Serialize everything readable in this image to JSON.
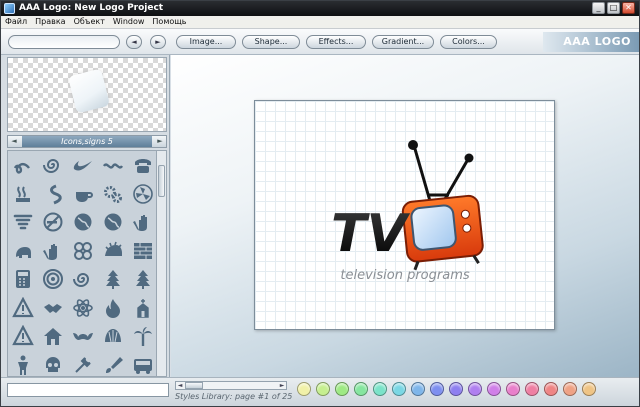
{
  "window": {
    "title": "AAA Logo: New Logo Project",
    "controls": {
      "minimize": "_",
      "maximize": "□",
      "close": "✕"
    }
  },
  "menu": {
    "items": [
      "Файл",
      "Правка",
      "Объект",
      "Window",
      "Помощь"
    ]
  },
  "toolbar": {
    "nav_back": "◄",
    "nav_forward": "►",
    "buttons": [
      "Image...",
      "Shape...",
      "Effects...",
      "Gradient...",
      "Colors..."
    ],
    "brand": "AAA LOGO"
  },
  "library": {
    "title": "Icons,signs 5",
    "prev": "◄",
    "next": "►",
    "icons": [
      "swirl-icon",
      "spiral-icon",
      "nike-swoosh-icon",
      "wave-icon",
      "telephone-icon",
      "steam-icon",
      "s-curve-icon",
      "coffee-cup-icon",
      "gears-icon",
      "fan-icon",
      "tornado-icon",
      "no-smoking-icon",
      "globe-icon",
      "globe-icon",
      "hand-icon",
      "elephant-icon",
      "hand-icon",
      "flower-icon",
      "hedgehog-icon",
      "brick-wall-icon",
      "calculator-icon",
      "target-icon",
      "spiral-icon",
      "tree-icon",
      "tree-icon",
      "warning-icon",
      "handshake-icon",
      "atom-icon",
      "fire-icon",
      "church-icon",
      "warning-icon",
      "house-icon",
      "bat-icon",
      "shell-icon",
      "palm-tree-icon",
      "figure-icon",
      "skull-icon",
      "tools-icon",
      "brush-icon",
      "bus-icon"
    ]
  },
  "logo": {
    "main_text": "TV",
    "tagline": "television programs"
  },
  "status": {
    "page_info": "Styles Library: page #1 of 25"
  },
  "colors": {
    "swatches": [
      "#f1f1a8",
      "#c6ef8f",
      "#9eea84",
      "#86e6a0",
      "#7be3c9",
      "#7ad7e4",
      "#7fb6ea",
      "#7e8ff0",
      "#8e7ff0",
      "#b07ff0",
      "#d07fe8",
      "#e97fcb",
      "#ef7fa3",
      "#ef8585",
      "#efa285",
      "#efc485"
    ]
  }
}
